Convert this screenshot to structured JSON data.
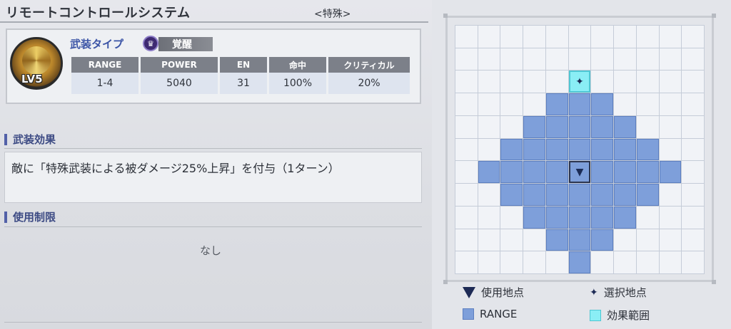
{
  "header": {
    "title": "リモートコントロールシステム",
    "category": "<特殊>"
  },
  "weapon": {
    "level": "LV5",
    "type_label": "武装タイプ",
    "awaken_label": "覚醒",
    "stats_headers": [
      "RANGE",
      "POWER",
      "EN",
      "命中",
      "クリティカル"
    ],
    "stats_values": [
      "1-4",
      "5040",
      "31",
      "100%",
      "20%"
    ]
  },
  "effect": {
    "heading": "武装効果",
    "text": "敵に「特殊武装による被ダメージ25%上昇」を付与（1ターン）"
  },
  "restriction": {
    "heading": "使用制限",
    "text": "なし"
  },
  "range_grid": {
    "size": 11,
    "range_cells": [
      [
        3,
        4
      ],
      [
        3,
        5
      ],
      [
        3,
        6
      ],
      [
        4,
        3
      ],
      [
        4,
        4
      ],
      [
        4,
        5
      ],
      [
        4,
        6
      ],
      [
        4,
        7
      ],
      [
        5,
        2
      ],
      [
        5,
        3
      ],
      [
        5,
        4
      ],
      [
        5,
        5
      ],
      [
        5,
        6
      ],
      [
        5,
        7
      ],
      [
        5,
        8
      ],
      [
        6,
        1
      ],
      [
        6,
        2
      ],
      [
        6,
        3
      ],
      [
        6,
        4
      ],
      [
        6,
        6
      ],
      [
        6,
        7
      ],
      [
        6,
        8
      ],
      [
        6,
        9
      ],
      [
        7,
        2
      ],
      [
        7,
        3
      ],
      [
        7,
        4
      ],
      [
        7,
        5
      ],
      [
        7,
        6
      ],
      [
        7,
        7
      ],
      [
        7,
        8
      ],
      [
        8,
        3
      ],
      [
        8,
        4
      ],
      [
        8,
        5
      ],
      [
        8,
        6
      ],
      [
        8,
        7
      ],
      [
        9,
        4
      ],
      [
        9,
        5
      ],
      [
        9,
        6
      ],
      [
        10,
        5
      ]
    ],
    "use_point": [
      6,
      5
    ],
    "effect_cells": [
      [
        2,
        5
      ]
    ],
    "select_point": [
      2,
      5
    ]
  },
  "legend": {
    "use_point": "使用地点",
    "select_point": "選択地点",
    "range": "RANGE",
    "effect_area": "効果範囲"
  },
  "colors": {
    "range": "#7e9fda",
    "effect": "#8aeef5",
    "use_marker": "#1d2a55",
    "accent": "#3b54a6"
  }
}
